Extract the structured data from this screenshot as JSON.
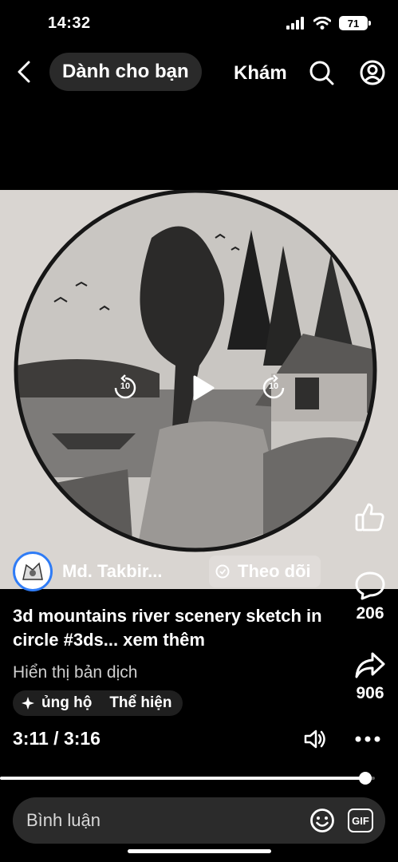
{
  "status_bar": {
    "time": "14:32",
    "battery": "71"
  },
  "nav": {
    "tabs": [
      {
        "label": "Dành cho bạn"
      },
      {
        "label": "Khám"
      }
    ]
  },
  "video": {
    "rewind_seconds": "10",
    "forward_seconds": "10"
  },
  "rail": {
    "comment_count": "206",
    "share_count": "906"
  },
  "author": {
    "name": "Md. Takbir...",
    "follow_label": "Theo dõi"
  },
  "post": {
    "title": "3d mountains river scenery sketch in circle #3ds...",
    "more_label": "xem thêm",
    "translate_label": "Hiển thị bản dịch",
    "chips": [
      "ủng hộ",
      "Thể hiện"
    ]
  },
  "playback": {
    "current": "3:11",
    "separator": "/",
    "duration": "3:16",
    "progress": 0.974
  },
  "comment": {
    "placeholder": "Bình luận",
    "gif_label": "GIF"
  }
}
